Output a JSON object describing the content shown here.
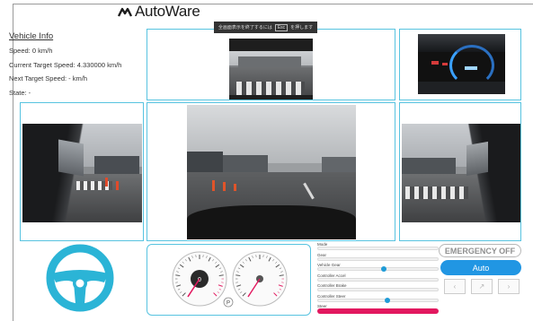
{
  "app": {
    "logo_text": "AutoWare"
  },
  "vehicle_info": {
    "title": "Vehicle Info",
    "speed": "Speed: 0 km/h",
    "current_target_speed": "Current Target Speed: 4.330000 km/h",
    "next_target_speed": "Next Target Speed: - km/h",
    "state": "State: -"
  },
  "banner": {
    "text": "全画面表示を終了するには",
    "key": "Esc",
    "suffix": "を押します"
  },
  "controls": {
    "items": [
      {
        "label": "Mode"
      },
      {
        "label": "Gear"
      },
      {
        "label": "Vehicle Gear"
      },
      {
        "label": "Controller Accel"
      },
      {
        "label": "Controller Brake"
      },
      {
        "label": "Controller Steer"
      },
      {
        "label": "Steer"
      }
    ],
    "sliders": {
      "vehicle_gear": 0.55,
      "controller_steer": 0.58
    }
  },
  "buttons": {
    "emergency": "EMERGENCY OFF",
    "auto": "Auto",
    "small_1": "‹",
    "small_2": "↗",
    "small_3": "›"
  },
  "colors": {
    "accent": "#57c3e0",
    "primary": "#2196e3",
    "danger": "#e2185f",
    "wheel": "#2bb4d6"
  }
}
